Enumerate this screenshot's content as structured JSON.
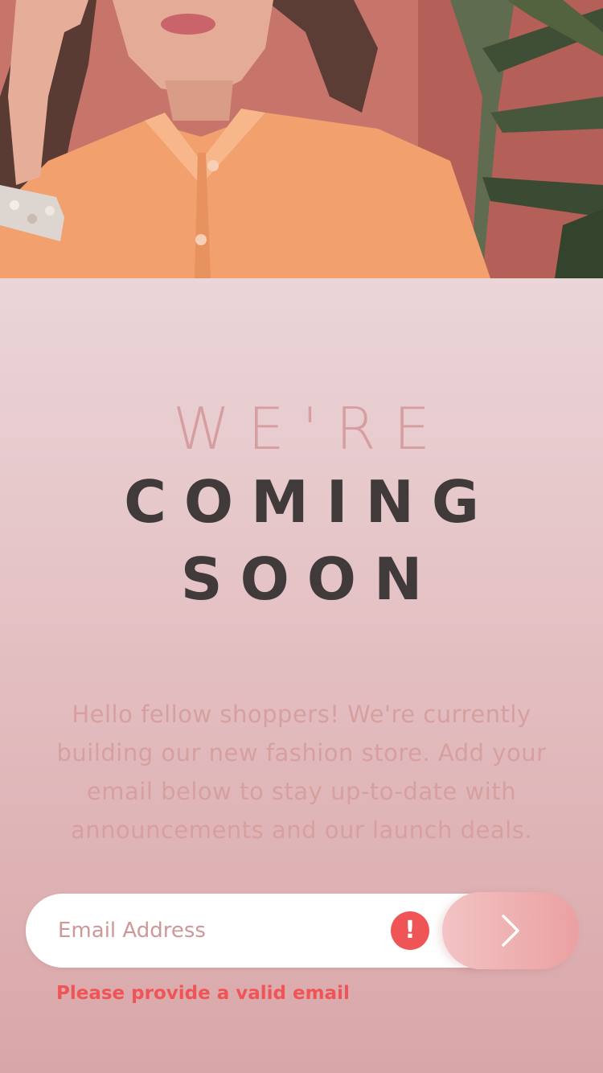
{
  "headline": {
    "line1": "WE'RE",
    "line2": "COMING",
    "line3": "SOON"
  },
  "intro": "Hello fellow shoppers! We're currently building our new fashion store. Add your email below to stay up-to-date with announcements and our launch deals.",
  "form": {
    "email_placeholder": "Email Address",
    "email_value": "",
    "error_icon_glyph": "!",
    "submit_icon": "chevron-right-icon",
    "error_message": "Please provide a valid email"
  },
  "colors": {
    "accent": "#ef5556",
    "heading_dark": "#403a3b",
    "heading_light": "#d69e9e",
    "body_text": "#d7a09f",
    "button_gradient_start": "#f3c3c4",
    "button_gradient_end": "#eba0a1"
  }
}
